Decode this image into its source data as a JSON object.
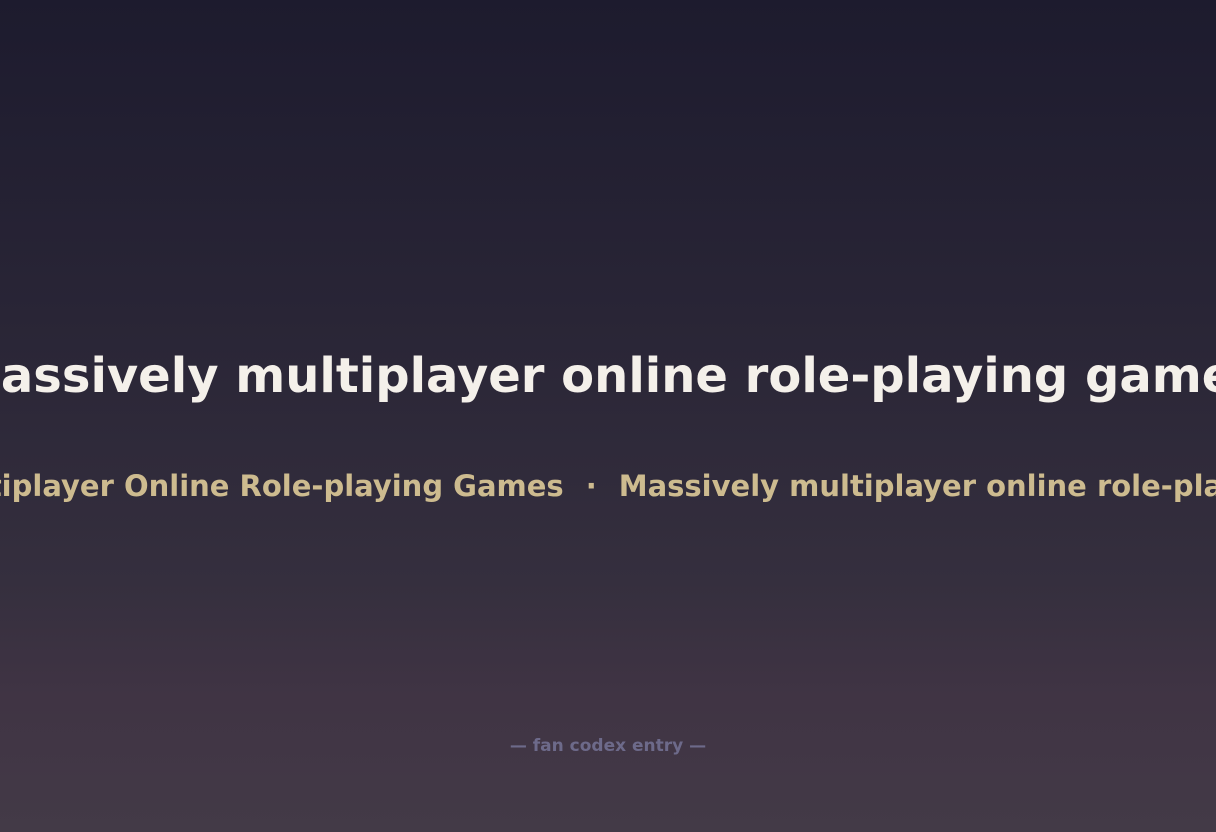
{
  "hero": {
    "title": "Massively multiplayer online role-playing games"
  },
  "ticker": {
    "items": [
      "Massively Multiplayer Online Role-playing Games",
      "Massively multiplayer online role-playing games"
    ],
    "separator": "·"
  },
  "footer": {
    "note": "— fan codex entry —"
  },
  "colors": {
    "title": "#f4f0ea",
    "ticker": "#cdbb8f",
    "footer": "#6d6a8a"
  }
}
